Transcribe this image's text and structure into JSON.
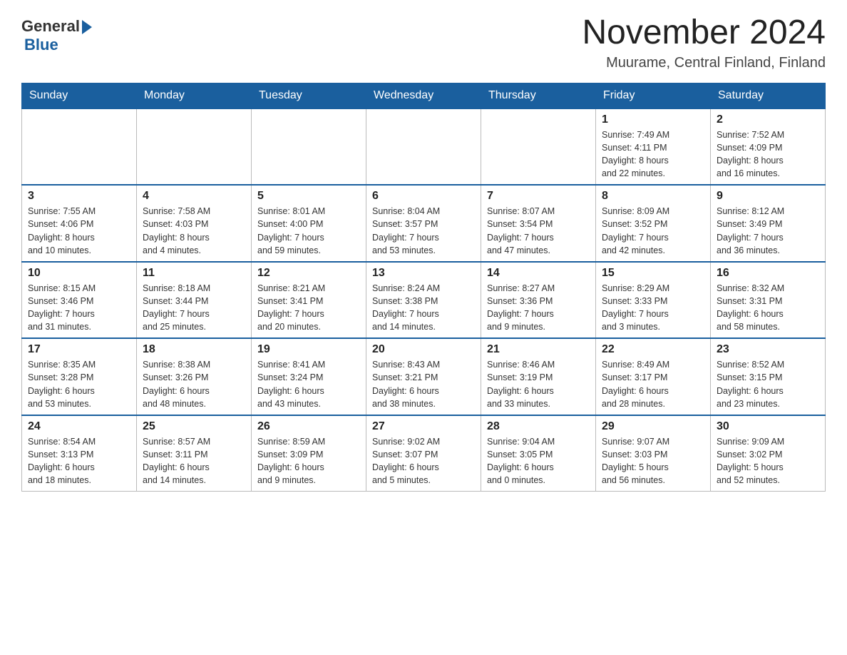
{
  "logo": {
    "general": "General",
    "blue": "Blue"
  },
  "title": "November 2024",
  "location": "Muurame, Central Finland, Finland",
  "weekdays": [
    "Sunday",
    "Monday",
    "Tuesday",
    "Wednesday",
    "Thursday",
    "Friday",
    "Saturday"
  ],
  "weeks": [
    [
      {
        "day": "",
        "info": ""
      },
      {
        "day": "",
        "info": ""
      },
      {
        "day": "",
        "info": ""
      },
      {
        "day": "",
        "info": ""
      },
      {
        "day": "",
        "info": ""
      },
      {
        "day": "1",
        "info": "Sunrise: 7:49 AM\nSunset: 4:11 PM\nDaylight: 8 hours\nand 22 minutes."
      },
      {
        "day": "2",
        "info": "Sunrise: 7:52 AM\nSunset: 4:09 PM\nDaylight: 8 hours\nand 16 minutes."
      }
    ],
    [
      {
        "day": "3",
        "info": "Sunrise: 7:55 AM\nSunset: 4:06 PM\nDaylight: 8 hours\nand 10 minutes."
      },
      {
        "day": "4",
        "info": "Sunrise: 7:58 AM\nSunset: 4:03 PM\nDaylight: 8 hours\nand 4 minutes."
      },
      {
        "day": "5",
        "info": "Sunrise: 8:01 AM\nSunset: 4:00 PM\nDaylight: 7 hours\nand 59 minutes."
      },
      {
        "day": "6",
        "info": "Sunrise: 8:04 AM\nSunset: 3:57 PM\nDaylight: 7 hours\nand 53 minutes."
      },
      {
        "day": "7",
        "info": "Sunrise: 8:07 AM\nSunset: 3:54 PM\nDaylight: 7 hours\nand 47 minutes."
      },
      {
        "day": "8",
        "info": "Sunrise: 8:09 AM\nSunset: 3:52 PM\nDaylight: 7 hours\nand 42 minutes."
      },
      {
        "day": "9",
        "info": "Sunrise: 8:12 AM\nSunset: 3:49 PM\nDaylight: 7 hours\nand 36 minutes."
      }
    ],
    [
      {
        "day": "10",
        "info": "Sunrise: 8:15 AM\nSunset: 3:46 PM\nDaylight: 7 hours\nand 31 minutes."
      },
      {
        "day": "11",
        "info": "Sunrise: 8:18 AM\nSunset: 3:44 PM\nDaylight: 7 hours\nand 25 minutes."
      },
      {
        "day": "12",
        "info": "Sunrise: 8:21 AM\nSunset: 3:41 PM\nDaylight: 7 hours\nand 20 minutes."
      },
      {
        "day": "13",
        "info": "Sunrise: 8:24 AM\nSunset: 3:38 PM\nDaylight: 7 hours\nand 14 minutes."
      },
      {
        "day": "14",
        "info": "Sunrise: 8:27 AM\nSunset: 3:36 PM\nDaylight: 7 hours\nand 9 minutes."
      },
      {
        "day": "15",
        "info": "Sunrise: 8:29 AM\nSunset: 3:33 PM\nDaylight: 7 hours\nand 3 minutes."
      },
      {
        "day": "16",
        "info": "Sunrise: 8:32 AM\nSunset: 3:31 PM\nDaylight: 6 hours\nand 58 minutes."
      }
    ],
    [
      {
        "day": "17",
        "info": "Sunrise: 8:35 AM\nSunset: 3:28 PM\nDaylight: 6 hours\nand 53 minutes."
      },
      {
        "day": "18",
        "info": "Sunrise: 8:38 AM\nSunset: 3:26 PM\nDaylight: 6 hours\nand 48 minutes."
      },
      {
        "day": "19",
        "info": "Sunrise: 8:41 AM\nSunset: 3:24 PM\nDaylight: 6 hours\nand 43 minutes."
      },
      {
        "day": "20",
        "info": "Sunrise: 8:43 AM\nSunset: 3:21 PM\nDaylight: 6 hours\nand 38 minutes."
      },
      {
        "day": "21",
        "info": "Sunrise: 8:46 AM\nSunset: 3:19 PM\nDaylight: 6 hours\nand 33 minutes."
      },
      {
        "day": "22",
        "info": "Sunrise: 8:49 AM\nSunset: 3:17 PM\nDaylight: 6 hours\nand 28 minutes."
      },
      {
        "day": "23",
        "info": "Sunrise: 8:52 AM\nSunset: 3:15 PM\nDaylight: 6 hours\nand 23 minutes."
      }
    ],
    [
      {
        "day": "24",
        "info": "Sunrise: 8:54 AM\nSunset: 3:13 PM\nDaylight: 6 hours\nand 18 minutes."
      },
      {
        "day": "25",
        "info": "Sunrise: 8:57 AM\nSunset: 3:11 PM\nDaylight: 6 hours\nand 14 minutes."
      },
      {
        "day": "26",
        "info": "Sunrise: 8:59 AM\nSunset: 3:09 PM\nDaylight: 6 hours\nand 9 minutes."
      },
      {
        "day": "27",
        "info": "Sunrise: 9:02 AM\nSunset: 3:07 PM\nDaylight: 6 hours\nand 5 minutes."
      },
      {
        "day": "28",
        "info": "Sunrise: 9:04 AM\nSunset: 3:05 PM\nDaylight: 6 hours\nand 0 minutes."
      },
      {
        "day": "29",
        "info": "Sunrise: 9:07 AM\nSunset: 3:03 PM\nDaylight: 5 hours\nand 56 minutes."
      },
      {
        "day": "30",
        "info": "Sunrise: 9:09 AM\nSunset: 3:02 PM\nDaylight: 5 hours\nand 52 minutes."
      }
    ]
  ]
}
